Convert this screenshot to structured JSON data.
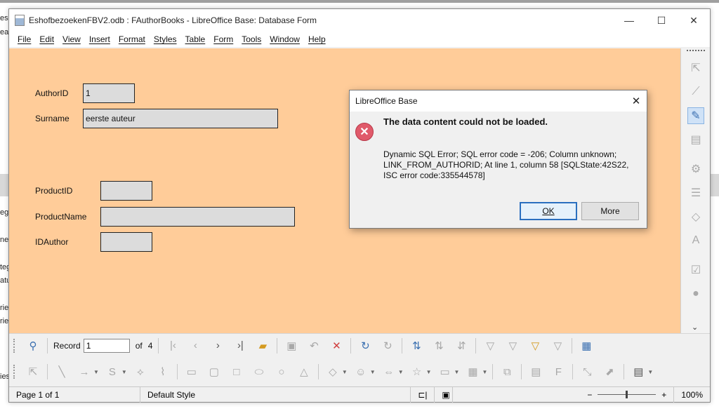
{
  "window": {
    "title": "EshofbezoekenFBV2.odb : FAuthorBooks - LibreOffice Base: Database Form",
    "controls": {
      "minimize": "—",
      "maximize": "☐",
      "close": "✕"
    }
  },
  "menu": [
    "File",
    "Edit",
    "View",
    "Insert",
    "Format",
    "Styles",
    "Table",
    "Form",
    "Tools",
    "Window",
    "Help"
  ],
  "form": {
    "author_id_label": "AuthorID",
    "author_id_value": "1",
    "surname_label": "Surname",
    "surname_value": "eerste auteur",
    "product_id_label": "ProductID",
    "product_id_value": "",
    "product_name_label": "ProductName",
    "product_name_value": "",
    "id_author_label": "IDAuthor",
    "id_author_value": ""
  },
  "navigation": {
    "record_label": "Record",
    "record_value": "1",
    "of_label": "of",
    "record_total": "4"
  },
  "status": {
    "page": "Page 1 of 1",
    "style": "Default Style",
    "zoom_minus": "−",
    "zoom_plus": "+",
    "zoom": "100%"
  },
  "dialog": {
    "title": "LibreOffice Base",
    "heading": "The data content could not be loaded.",
    "message": "Dynamic SQL Error; SQL error code = -206; Column unknown; LINK_FROM_AUTHORID; At line 1, column 58 [SQLState:42S22, ISC error code:335544578]",
    "ok_label": "OK",
    "more_label": "More"
  },
  "background": {
    "left_fragments": [
      "esi",
      "eat",
      "eg",
      "ner",
      "teg",
      "atu",
      "rie",
      "rie",
      "ies"
    ]
  },
  "colors": {
    "form_background": "#ffcc99",
    "field_background": "#dcdcdc",
    "error_icon": "#e05a6a",
    "accent": "#2a6fbf"
  },
  "icons": {
    "sidebar": [
      "select-icon",
      "design-mode-icon",
      "wizard-icon",
      "form-navigator-icon",
      "properties-icon",
      "list-icon",
      "label-icon",
      "text-field-icon",
      "checkbox-icon",
      "option-icon"
    ],
    "nav_toolbar": [
      "find-icon",
      "first-icon",
      "previous-icon",
      "next-icon",
      "last-icon",
      "open-icon",
      "save-icon",
      "undo-icon",
      "delete-icon",
      "refresh-icon",
      "refresh-control-icon",
      "sort-asc-icon",
      "sort-desc-icon",
      "sort-icon",
      "autofilter-icon",
      "filter-icon",
      "apply-filter-icon",
      "reset-filter-icon",
      "data-source-icon"
    ],
    "draw_toolbar": [
      "select-icon",
      "line-icon",
      "arrow-icon",
      "curve-icon",
      "polygon-icon",
      "freeform-icon",
      "rectangle-icon",
      "rounded-rect-icon",
      "square-icon",
      "ellipse-icon",
      "circle-icon",
      "triangle-icon",
      "diamond-icon",
      "smiley-icon",
      "double-arrow-icon",
      "star-icon",
      "callout-icon",
      "flowchart-icon",
      "group-icon",
      "text-box-icon",
      "fontwork-icon",
      "points-icon",
      "extrusion-icon",
      "insert-image-icon"
    ]
  }
}
